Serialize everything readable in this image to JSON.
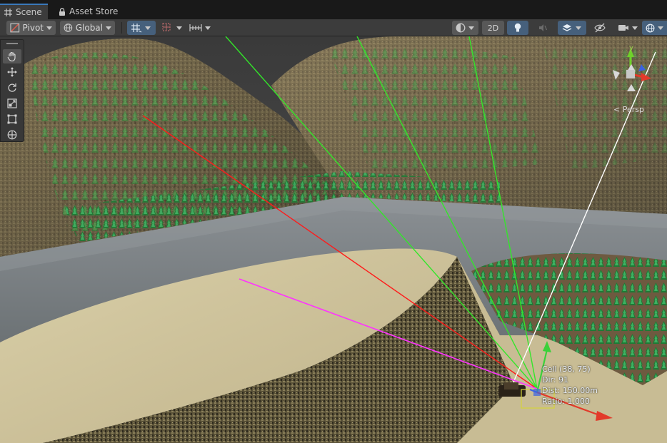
{
  "tabs": [
    {
      "label": "Scene",
      "icon": "grid-icon",
      "active": true
    },
    {
      "label": "Asset Store",
      "icon": "lock-icon",
      "active": false
    }
  ],
  "toolbar": {
    "pivot_label": "Pivot",
    "global_label": "Global",
    "mode_2d_label": "2D"
  },
  "gizmo": {
    "persp_label": "< Persp",
    "axis_y_label": "y"
  },
  "overlay": {
    "cell": "Cell (38, 75)",
    "dir": "Dir: 91",
    "dist": "Dist: 150.00m",
    "ratio": "Ratio: 1.000"
  },
  "colors": {
    "accent": "#3a79bb",
    "ray_red": "#ff1a1a",
    "ray_green": "#33e62a",
    "ray_white": "#ffffff",
    "ray_magenta": "#ff33ff",
    "water": "#7c8286",
    "sand": "#cfc49a"
  }
}
